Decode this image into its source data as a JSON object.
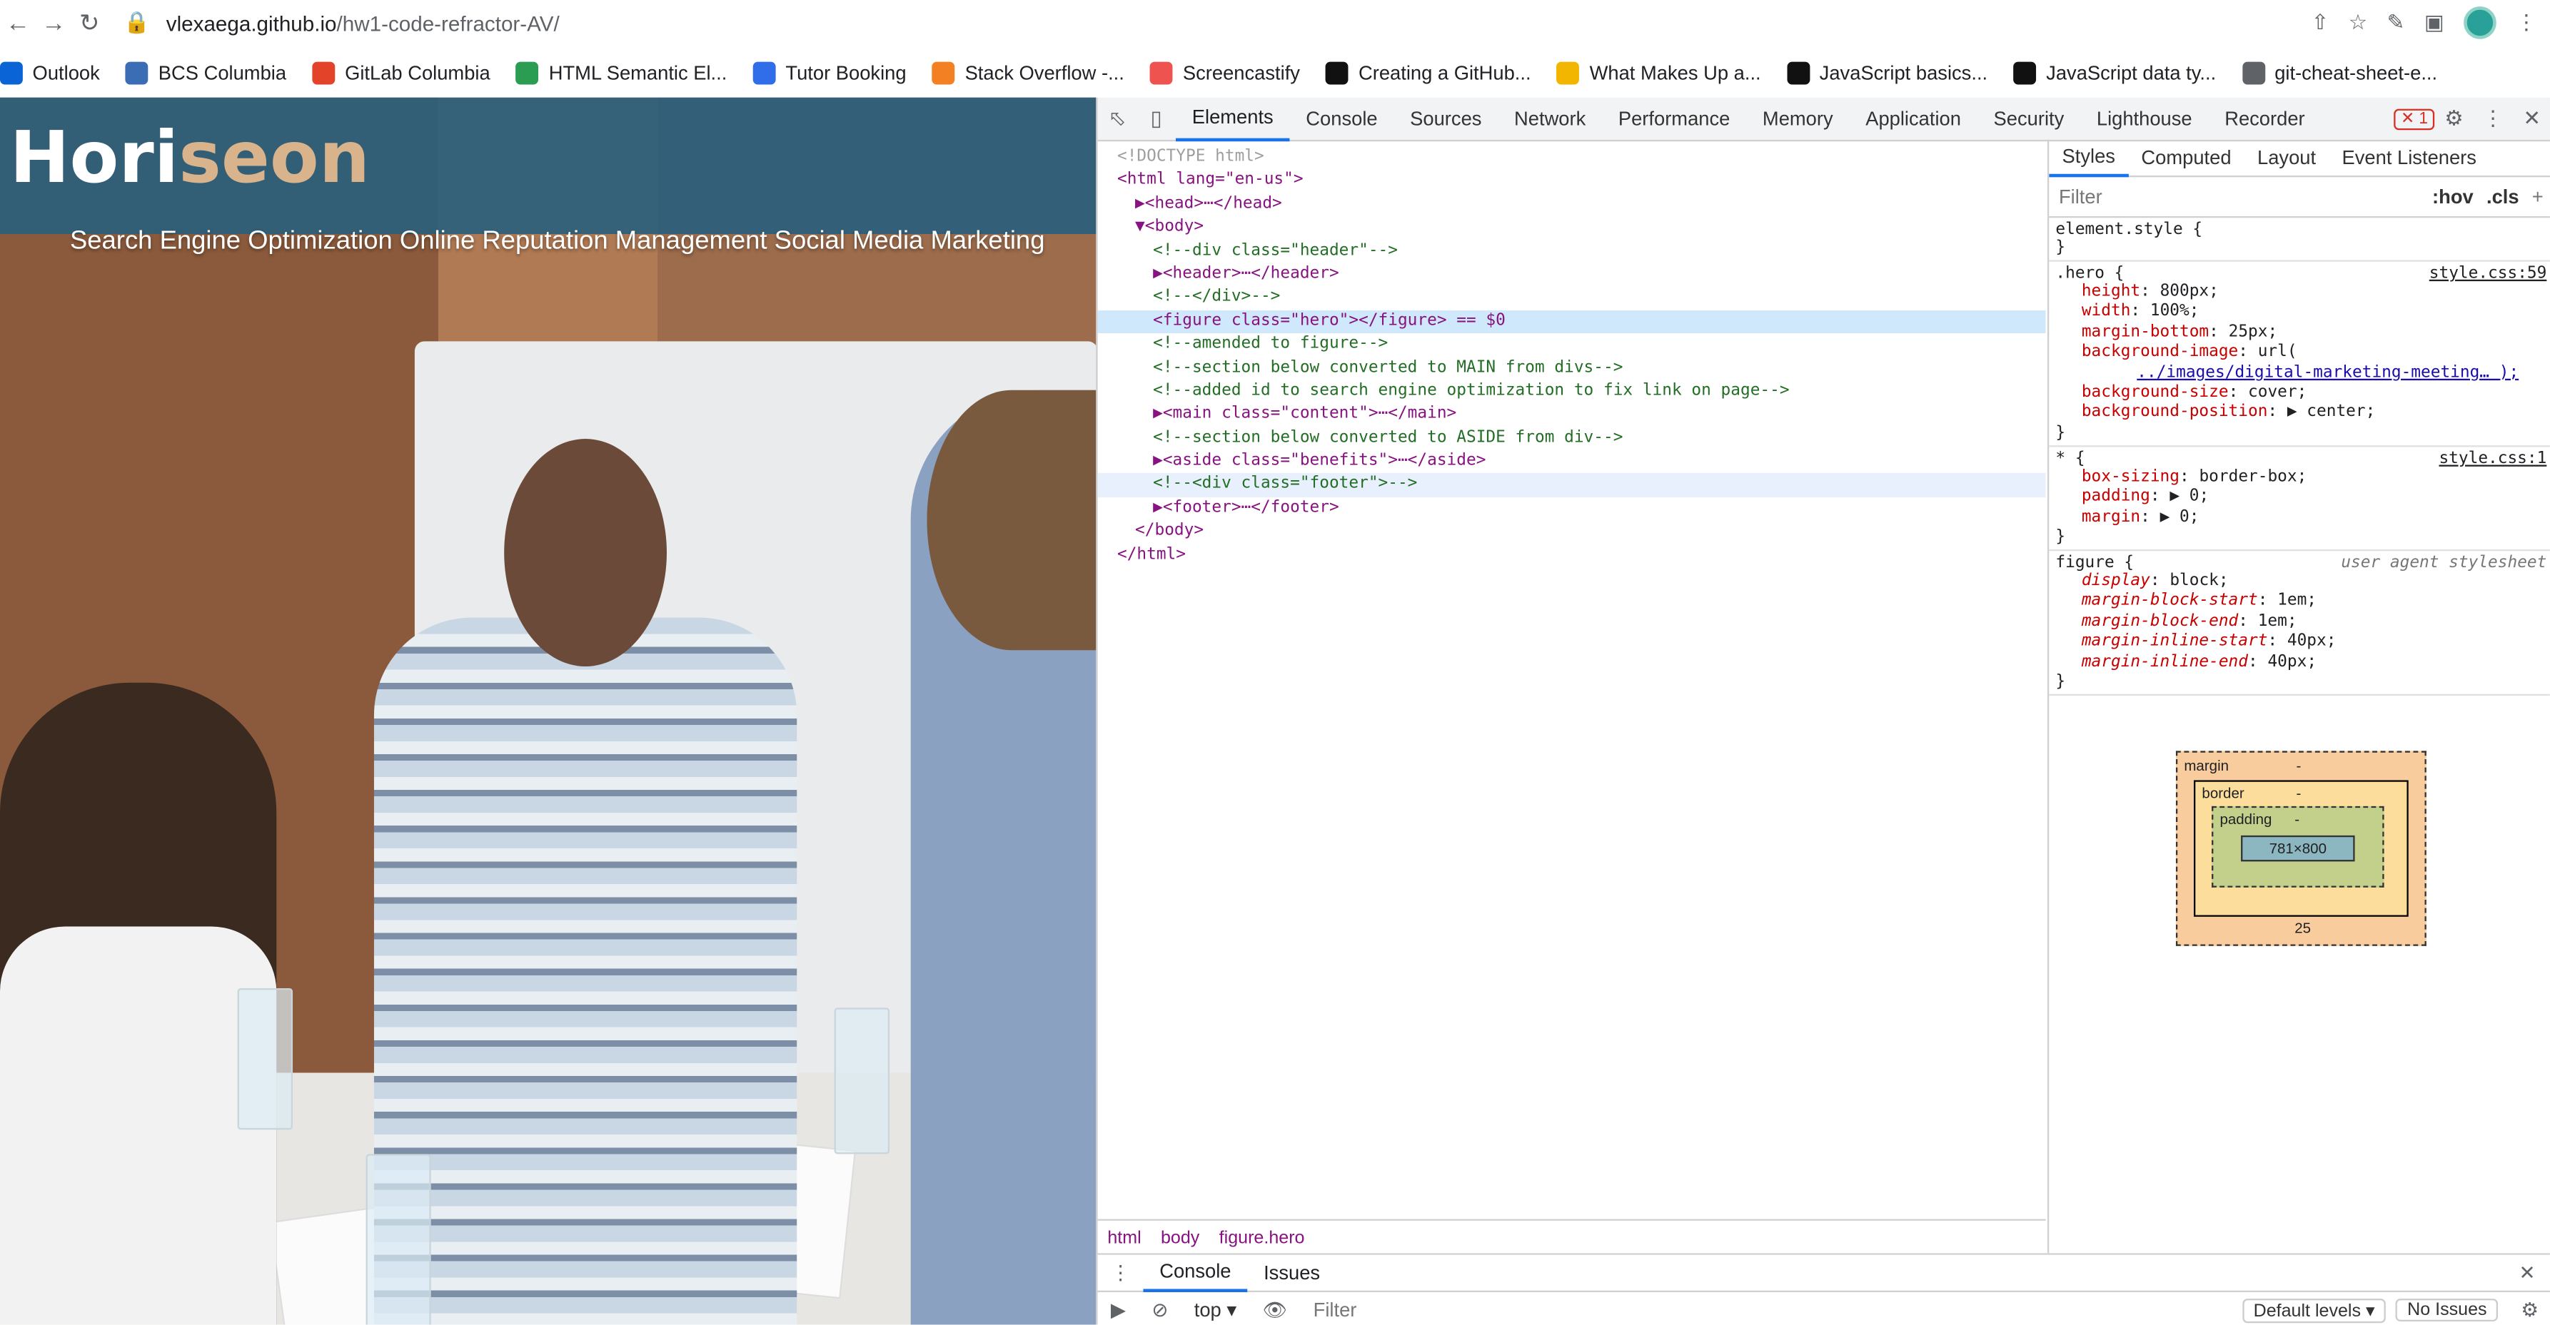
{
  "browser": {
    "url_host": "vlexaega.github.io",
    "url_path": "/hw1-code-refractor-AV/",
    "bookmarks": [
      {
        "label": "Outlook",
        "color": "#0a64d6"
      },
      {
        "label": "BCS Columbia",
        "color": "#3b6db4"
      },
      {
        "label": "GitLab Columbia",
        "color": "#e24329"
      },
      {
        "label": "HTML Semantic El...",
        "color": "#2a9d52"
      },
      {
        "label": "Tutor Booking",
        "color": "#2f6ee8"
      },
      {
        "label": "Stack Overflow -...",
        "color": "#f48024"
      },
      {
        "label": "Screencastify",
        "color": "#ef5350"
      },
      {
        "label": "Creating a GitHub...",
        "color": "#111111"
      },
      {
        "label": "What Makes Up a...",
        "color": "#f2b600"
      },
      {
        "label": "JavaScript basics...",
        "color": "#111111"
      },
      {
        "label": "JavaScript data ty...",
        "color": "#111111"
      },
      {
        "label": "git-cheat-sheet-e...",
        "color": "#5f6368"
      }
    ]
  },
  "site": {
    "logo_main": "Hori",
    "logo_accent": "seon",
    "nav": "Search Engine Optimization Online Reputation Management Social Media Marketing"
  },
  "devtools": {
    "tabs": [
      "Elements",
      "Console",
      "Sources",
      "Network",
      "Performance",
      "Memory",
      "Application",
      "Security",
      "Lighthouse",
      "Recorder"
    ],
    "error_count": "1",
    "dom_lines": [
      {
        "text": "<!DOCTYPE html>",
        "cls": "muted",
        "indent": 0
      },
      {
        "text": "<html lang=\"en-us\">",
        "cls": "",
        "indent": 0
      },
      {
        "text": "▶<head>⋯</head>",
        "cls": "",
        "indent": 1
      },
      {
        "text": "▼<body>",
        "cls": "",
        "indent": 1
      },
      {
        "text": "<!--div class=\"header\"-->",
        "cls": "comment",
        "indent": 2
      },
      {
        "text": "▶<header>⋯</header>",
        "cls": "",
        "indent": 2
      },
      {
        "text": "<!--</div>-->",
        "cls": "comment",
        "indent": 2
      },
      {
        "text": "<figure class=\"hero\"></figure> == $0",
        "cls": "sel",
        "indent": 2
      },
      {
        "text": "<!--amended to figure-->",
        "cls": "comment",
        "indent": 2
      },
      {
        "text": "<!--section below converted to MAIN from divs-->",
        "cls": "comment",
        "indent": 2
      },
      {
        "text": "<!--added id to search engine optimization to fix link on page-->",
        "cls": "comment",
        "indent": 2
      },
      {
        "text": "▶<main class=\"content\">⋯</main>",
        "cls": "",
        "indent": 2
      },
      {
        "text": "<!--section below converted to ASIDE from div-->",
        "cls": "comment",
        "indent": 2
      },
      {
        "text": "▶<aside class=\"benefits\">⋯</aside>",
        "cls": "",
        "indent": 2
      },
      {
        "text": "<!--<div class=\"footer\">-->",
        "cls": "comment hov",
        "indent": 2
      },
      {
        "text": "▶<footer>⋯</footer>",
        "cls": "",
        "indent": 2
      },
      {
        "text": "</body>",
        "cls": "",
        "indent": 1
      },
      {
        "text": "</html>",
        "cls": "",
        "indent": 0
      }
    ],
    "breadcrumb": [
      "html",
      "body",
      "figure.hero"
    ],
    "styles_tabs": [
      "Styles",
      "Computed",
      "Layout",
      "Event Listeners"
    ],
    "filter_placeholder": "Filter",
    "hov": ":hov",
    "cls": ".cls",
    "rules": [
      {
        "selector": "element.style {",
        "source": "",
        "props": []
      },
      {
        "selector": ".hero {",
        "source": "style.css:59",
        "props": [
          {
            "n": "height",
            "v": "800px;"
          },
          {
            "n": "width",
            "v": "100%;"
          },
          {
            "n": "margin-bottom",
            "v": "25px;"
          },
          {
            "n": "background-image",
            "v": "url("
          },
          {
            "n": "",
            "v": "../images/digital-marketing-meeting… );"
          },
          {
            "n": "background-size",
            "v": "cover;"
          },
          {
            "n": "background-position",
            "v": "▶ center;"
          }
        ]
      },
      {
        "selector": "* {",
        "source": "style.css:1",
        "props": [
          {
            "n": "box-sizing",
            "v": "border-box;"
          },
          {
            "n": "padding",
            "v": "▶ 0;"
          },
          {
            "n": "margin",
            "v": "▶ 0;"
          }
        ]
      },
      {
        "selector": "figure {",
        "source": "user agent stylesheet",
        "props": [
          {
            "n": "display",
            "v": "block;"
          },
          {
            "n": "margin-block-start",
            "v": "1em;"
          },
          {
            "n": "margin-block-end",
            "v": "1em;"
          },
          {
            "n": "margin-inline-start",
            "v": "40px;"
          },
          {
            "n": "margin-inline-end",
            "v": "40px;"
          }
        ]
      }
    ],
    "boxmodel": {
      "margin_label": "margin",
      "border_label": "border",
      "padding_label": "padding",
      "content": "781×800",
      "margin_bottom": "25",
      "dash": "-"
    },
    "drawer_tabs": [
      "Console",
      "Issues"
    ],
    "console_context": "top ▾",
    "console_filter": "Filter",
    "default_levels": "Default levels ▾",
    "no_issues": "No Issues"
  }
}
